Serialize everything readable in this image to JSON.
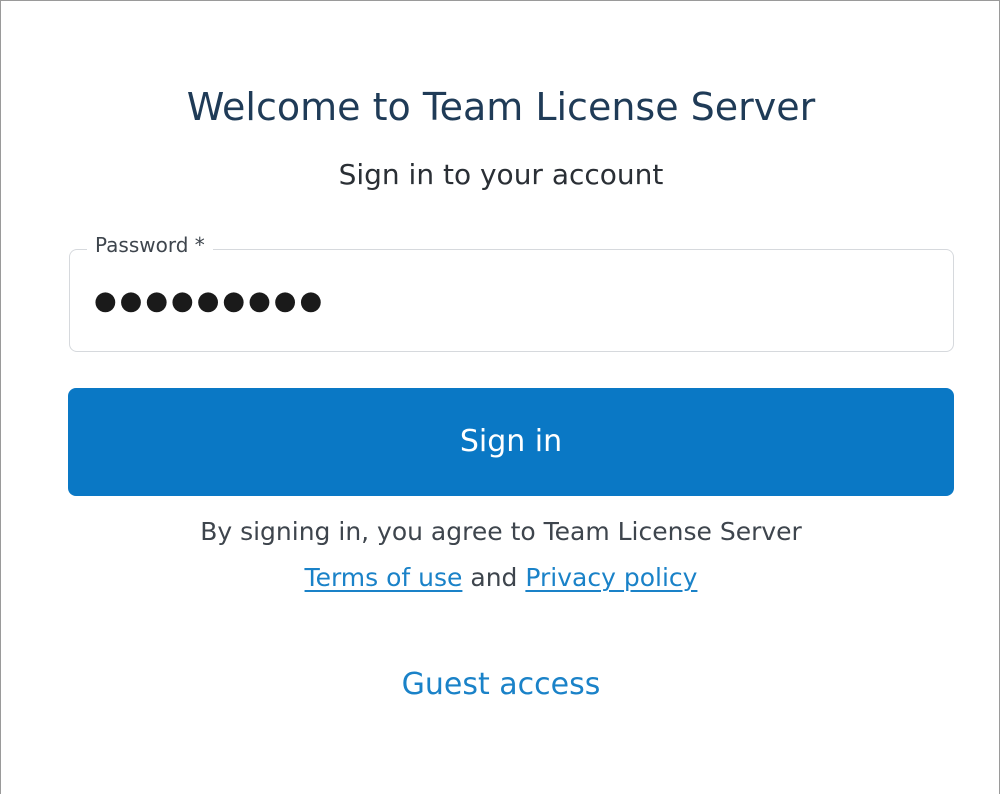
{
  "header": {
    "title": "Welcome to Team License Server",
    "subtitle": "Sign in to your account"
  },
  "form": {
    "password_label": "Password *",
    "password_value": "●●●●●●●●●",
    "signin_label": "Sign in"
  },
  "legal": {
    "agree_text": "By signing in, you agree to Team License Server",
    "terms_label": "Terms of use",
    "and_text": "and",
    "privacy_label": "Privacy policy"
  },
  "guest": {
    "label": "Guest access"
  },
  "colors": {
    "primary": "#0a78c5",
    "link": "#1a82c8",
    "title": "#1f3b57"
  }
}
